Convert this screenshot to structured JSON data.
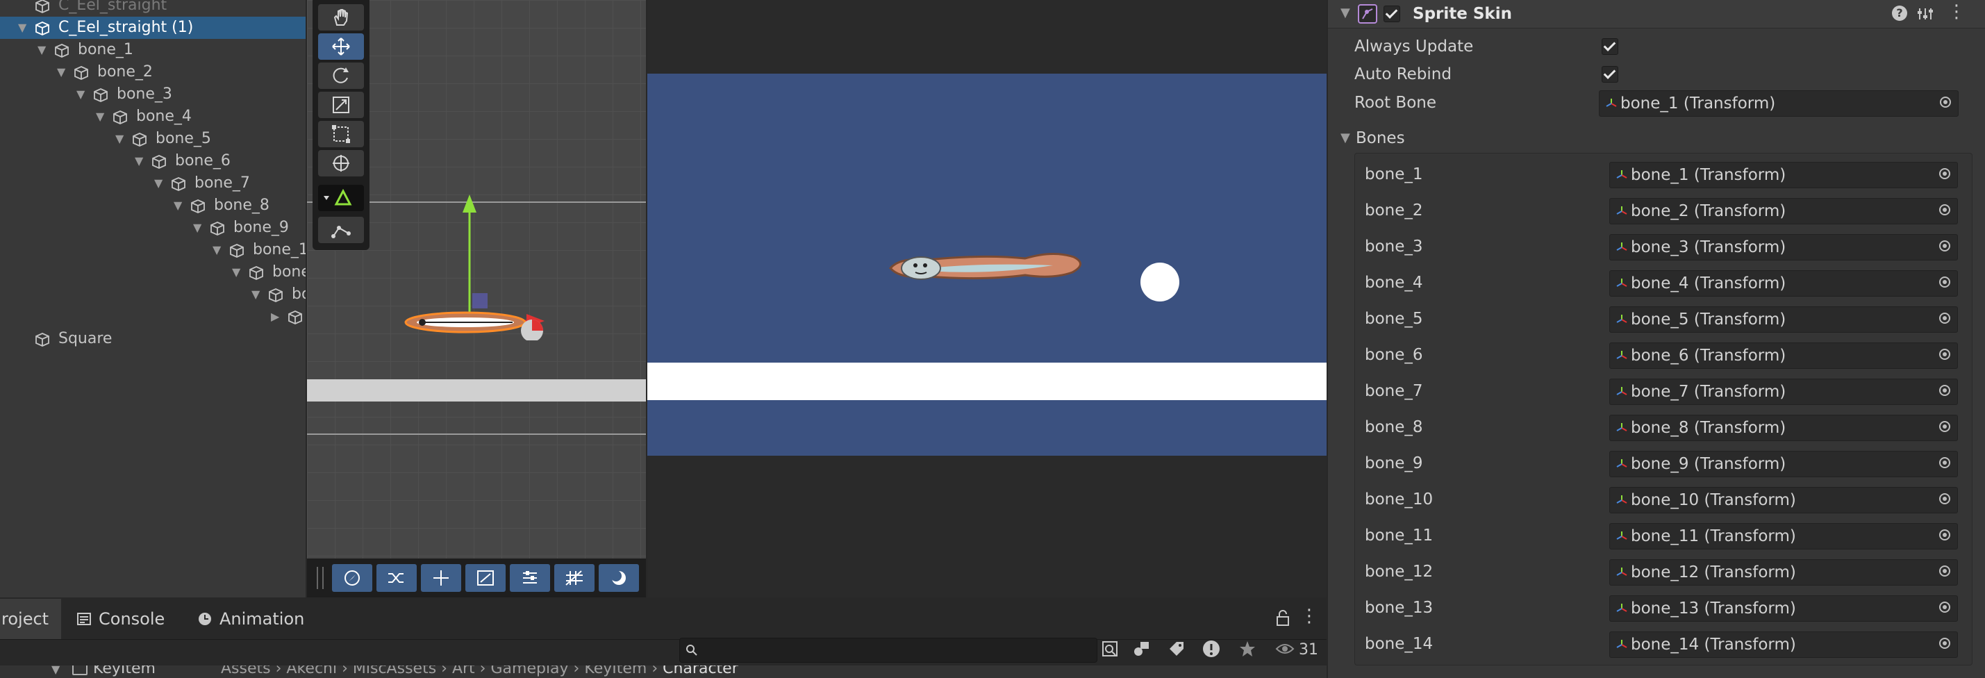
{
  "hierarchy": {
    "items": [
      {
        "label": "C_Eel_straight",
        "depth": 0,
        "arrow": "",
        "selected": false,
        "dim": true
      },
      {
        "label": "C_Eel_straight (1)",
        "depth": 0,
        "arrow": "down",
        "selected": true,
        "dim": false
      },
      {
        "label": "bone_1",
        "depth": 1,
        "arrow": "down",
        "selected": false,
        "dim": false
      },
      {
        "label": "bone_2",
        "depth": 2,
        "arrow": "down",
        "selected": false,
        "dim": false
      },
      {
        "label": "bone_3",
        "depth": 3,
        "arrow": "down",
        "selected": false,
        "dim": false
      },
      {
        "label": "bone_4",
        "depth": 4,
        "arrow": "down",
        "selected": false,
        "dim": false
      },
      {
        "label": "bone_5",
        "depth": 5,
        "arrow": "down",
        "selected": false,
        "dim": false
      },
      {
        "label": "bone_6",
        "depth": 6,
        "arrow": "down",
        "selected": false,
        "dim": false
      },
      {
        "label": "bone_7",
        "depth": 7,
        "arrow": "down",
        "selected": false,
        "dim": false
      },
      {
        "label": "bone_8",
        "depth": 8,
        "arrow": "down",
        "selected": false,
        "dim": false
      },
      {
        "label": "bone_9",
        "depth": 9,
        "arrow": "down",
        "selected": false,
        "dim": false
      },
      {
        "label": "bone_1",
        "depth": 10,
        "arrow": "down",
        "selected": false,
        "dim": false
      },
      {
        "label": "bone",
        "depth": 11,
        "arrow": "down",
        "selected": false,
        "dim": false
      },
      {
        "label": "bo",
        "depth": 12,
        "arrow": "down",
        "selected": false,
        "dim": false
      },
      {
        "label": "",
        "depth": 13,
        "arrow": "right",
        "selected": false,
        "dim": false
      },
      {
        "label": "Square",
        "depth": 0,
        "arrow": "",
        "selected": false,
        "dim": false
      }
    ]
  },
  "scene": {
    "tools": [
      "hand-tool",
      "move-tool",
      "rotate-tool",
      "scale-tool",
      "rect-tool",
      "transform-tool"
    ],
    "extra_tools": [
      "custom-tool-dropdown",
      "bone-tool"
    ],
    "bottom_tools": [
      "orient-icon",
      "shuffle-icon",
      "move-icon",
      "resize-icon",
      "align-icon",
      "grid-icon",
      "sphere-icon"
    ]
  },
  "inspector": {
    "component_title": "Sprite Skin",
    "always_update_label": "Always Update",
    "always_update": true,
    "auto_rebind_label": "Auto Rebind",
    "auto_rebind": true,
    "root_bone_label": "Root Bone",
    "root_bone_value": "bone_1 (Transform)",
    "bones_label": "Bones",
    "bones": [
      {
        "label": "bone_1",
        "value": "bone_1 (Transform)"
      },
      {
        "label": "bone_2",
        "value": "bone_2 (Transform)"
      },
      {
        "label": "bone_3",
        "value": "bone_3 (Transform)"
      },
      {
        "label": "bone_4",
        "value": "bone_4 (Transform)"
      },
      {
        "label": "bone_5",
        "value": "bone_5 (Transform)"
      },
      {
        "label": "bone_6",
        "value": "bone_6 (Transform)"
      },
      {
        "label": "bone_7",
        "value": "bone_7 (Transform)"
      },
      {
        "label": "bone_8",
        "value": "bone_8 (Transform)"
      },
      {
        "label": "bone_9",
        "value": "bone_9 (Transform)"
      },
      {
        "label": "bone_10",
        "value": "bone_10 (Transform)"
      },
      {
        "label": "bone_11",
        "value": "bone_11 (Transform)"
      },
      {
        "label": "bone_12",
        "value": "bone_12 (Transform)"
      },
      {
        "label": "bone_13",
        "value": "bone_13 (Transform)"
      },
      {
        "label": "bone_14",
        "value": "bone_14 (Transform)"
      }
    ]
  },
  "bottom": {
    "tabs": [
      "roject",
      "Console",
      "Animation"
    ],
    "visibility_count": "31",
    "search_value": "",
    "tree_item": "KeyItem",
    "breadcrumb": [
      "Assets",
      "Akechi",
      "MiscAssets",
      "Art",
      "Gameplay",
      "KeyItem",
      "Character"
    ]
  },
  "colors": {
    "selection": "#2c5d87",
    "game_background": "#3b5180",
    "tool_active": "#3e5f8a",
    "gizmo_y": "#8fe03b",
    "gizmo_x": "#e03232"
  }
}
